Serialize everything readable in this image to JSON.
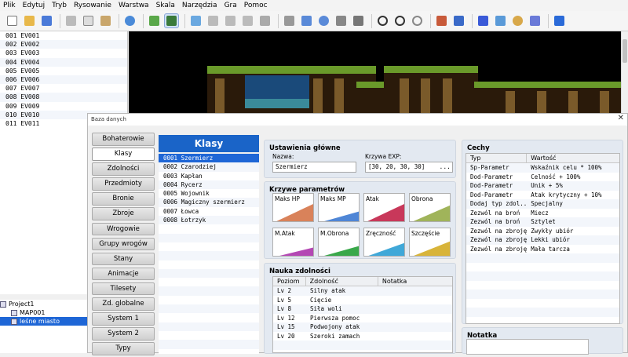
{
  "menu": [
    "Plik",
    "Edytuj",
    "Tryb",
    "Rysowanie",
    "Warstwa",
    "Skala",
    "Narzędzia",
    "Gra",
    "Pomoc"
  ],
  "events": [
    "001 EV001",
    "002 EV002",
    "003 EV003",
    "004 EV004",
    "005 EV005",
    "006 EV006",
    "007 EV007",
    "008 EV008",
    "009 EV009",
    "010 EV010",
    "011 EV011"
  ],
  "tree": {
    "project": "Project1",
    "map1": "MAP001",
    "map2": "leśne miasto"
  },
  "dialog": {
    "title": "Baza danych",
    "close": "✕"
  },
  "sidebar": [
    "Bohaterowie",
    "Klasy",
    "Zdolności",
    "Przedmioty",
    "Bronie",
    "Zbroje",
    "Wrogowie",
    "Grupy wrogów",
    "Stany",
    "Animacje",
    "Tilesety",
    "Zd. globalne",
    "System 1",
    "System 2",
    "Typy"
  ],
  "classes": {
    "header": "Klasy",
    "items": [
      "0001 Szermierz",
      "0002 Czarodziej",
      "0003 Kapłan",
      "0004 Rycerz",
      "0005 Wojownik",
      "0006 Magiczny szermierz",
      "0007 Łowca",
      "0008 Łotrzyk"
    ]
  },
  "general": {
    "title": "Ustawienia główne",
    "name_label": "Nazwa:",
    "name_value": "Szermierz",
    "exp_label": "Krzywa EXP:",
    "exp_value": "[30, 20, 30, 30]",
    "exp_button": "..."
  },
  "curves": {
    "title": "Krzywe parametrów",
    "items": [
      {
        "label": "Maks HP",
        "color": "#d9825a"
      },
      {
        "label": "Maks MP",
        "color": "#4f86d6"
      },
      {
        "label": "Atak",
        "color": "#c8385a"
      },
      {
        "label": "Obrona",
        "color": "#a0b45a"
      },
      {
        "label": "M.Atak",
        "color": "#b448b4"
      },
      {
        "label": "M.Obrona",
        "color": "#3aa84a"
      },
      {
        "label": "Zręczność",
        "color": "#40a8d8"
      },
      {
        "label": "Szczęście",
        "color": "#d8b43a"
      }
    ]
  },
  "skills": {
    "title": "Nauka zdolności",
    "columns": [
      "Poziom",
      "Zdolność",
      "Notatka"
    ],
    "rows": [
      [
        "Lv  2",
        "Silny atak"
      ],
      [
        "Lv  5",
        "Cięcie"
      ],
      [
        "Lv  8",
        "Siła woli"
      ],
      [
        "Lv 12",
        "Pierwsza pomoc"
      ],
      [
        "Lv 15",
        "Podwojony atak"
      ],
      [
        "Lv 20",
        "Szeroki zamach"
      ]
    ]
  },
  "traits": {
    "title": "Cechy",
    "columns": [
      "Typ",
      "Wartość"
    ],
    "rows": [
      [
        "Sp-Parametr",
        "Wskaźnik celu * 100%"
      ],
      [
        "Dod-Parametr",
        "Celność + 100%"
      ],
      [
        "Dod-Parametr",
        "Unik + 5%"
      ],
      [
        "Dod-Parametr",
        "Atak krytyczny + 10%"
      ],
      [
        "Dodaj typ zdol...",
        "Specjalny"
      ],
      [
        "Zezwól na broń",
        "Miecz"
      ],
      [
        "Zezwól na broń",
        "Sztylet"
      ],
      [
        "Zezwól na zbroję",
        "Zwykły ubiór"
      ],
      [
        "Zezwól na zbroję",
        "Lekki ubiór"
      ],
      [
        "Zezwól na zbroję",
        "Mała tarcza"
      ]
    ]
  },
  "note": {
    "title": "Notatka"
  },
  "toolbar_icons": [
    "new-icon",
    "open-icon",
    "save-icon",
    "cut-icon",
    "copy-icon",
    "paste-icon",
    "undo-icon",
    "map-mode-icon",
    "event-mode-icon",
    "layer1-icon",
    "layer2-icon",
    "layer3-icon",
    "layer4-icon",
    "layer5-icon",
    "pencil-icon",
    "rectangle-icon",
    "ellipse-icon",
    "fill-icon",
    "shadow-pen-icon",
    "zoom-in-icon",
    "zoom-out-icon",
    "zoom-actual-icon",
    "database-icon",
    "plugin-icon",
    "sound-icon",
    "resource-icon",
    "character-gen-icon",
    "event-search-icon",
    "playtest-icon"
  ]
}
